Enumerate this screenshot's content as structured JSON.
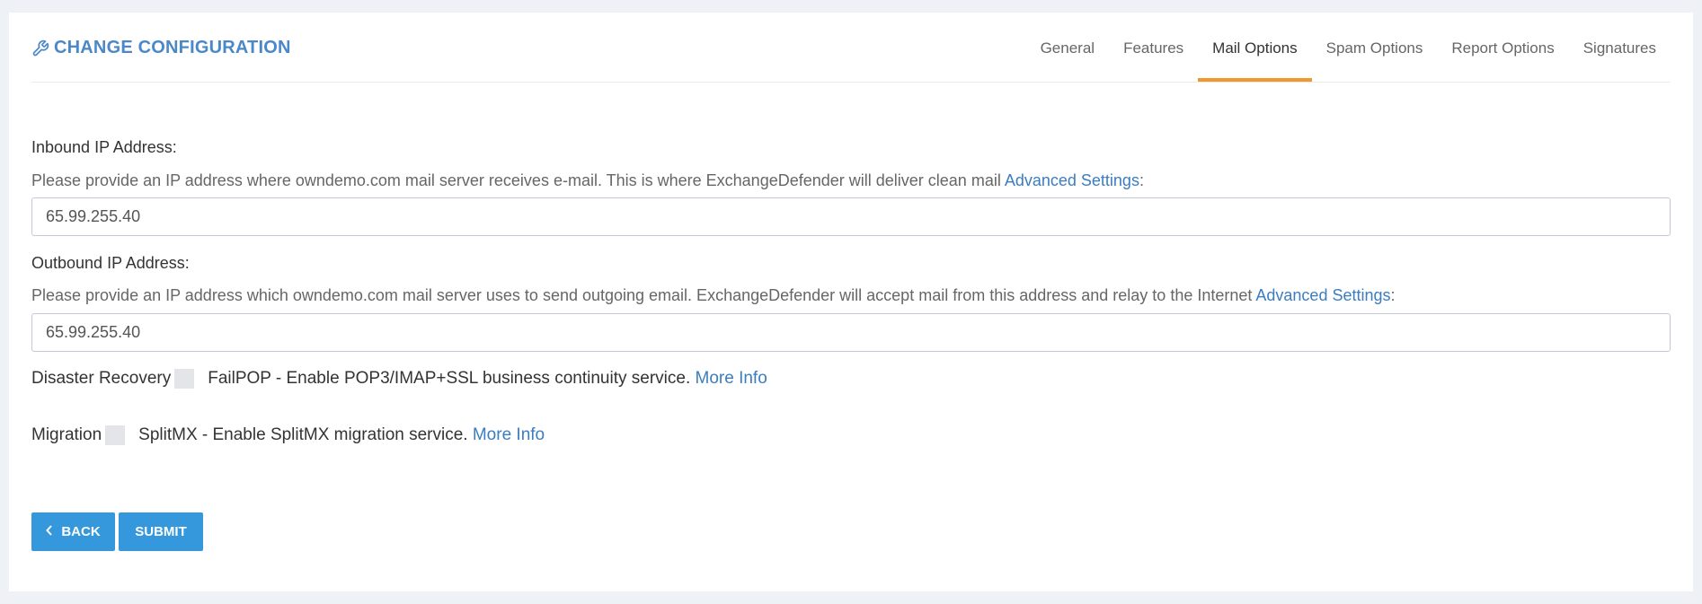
{
  "header": {
    "title": "CHANGE CONFIGURATION",
    "title_icon": "wrench-icon",
    "tabs": [
      {
        "label": "General",
        "active": false
      },
      {
        "label": "Features",
        "active": false
      },
      {
        "label": "Mail Options",
        "active": true
      },
      {
        "label": "Spam Options",
        "active": false
      },
      {
        "label": "Report Options",
        "active": false
      },
      {
        "label": "Signatures",
        "active": false
      }
    ]
  },
  "inbound": {
    "label": "Inbound IP Address:",
    "help_text": "Please provide an IP address where owndemo.com mail server receives e-mail. This is where ExchangeDefender will deliver clean mail ",
    "help_link": "Advanced Settings",
    "help_suffix": ":",
    "value": "65.99.255.40"
  },
  "outbound": {
    "label": "Outbound IP Address:",
    "help_text": "Please provide an IP address which owndemo.com mail server uses to send outgoing email. ExchangeDefender will accept mail from this address and relay to the Internet ",
    "help_link": "Advanced Settings",
    "help_suffix": ":",
    "value": "65.99.255.40"
  },
  "disaster_recovery": {
    "label": "Disaster Recovery",
    "checked": false,
    "description": "FailPOP - Enable POP3/IMAP+SSL business continuity service. ",
    "link": "More Info"
  },
  "migration": {
    "label": "Migration",
    "checked": false,
    "description": "SplitMX - Enable SplitMX migration service. ",
    "link": "More Info"
  },
  "buttons": {
    "back": "BACK",
    "submit": "SUBMIT",
    "back_icon": "chevron-left-icon"
  },
  "colors": {
    "accent_blue": "#3598dc",
    "title_blue": "#4a88c8",
    "link_blue": "#3a7dc0",
    "active_tab_orange": "#f3972c"
  }
}
